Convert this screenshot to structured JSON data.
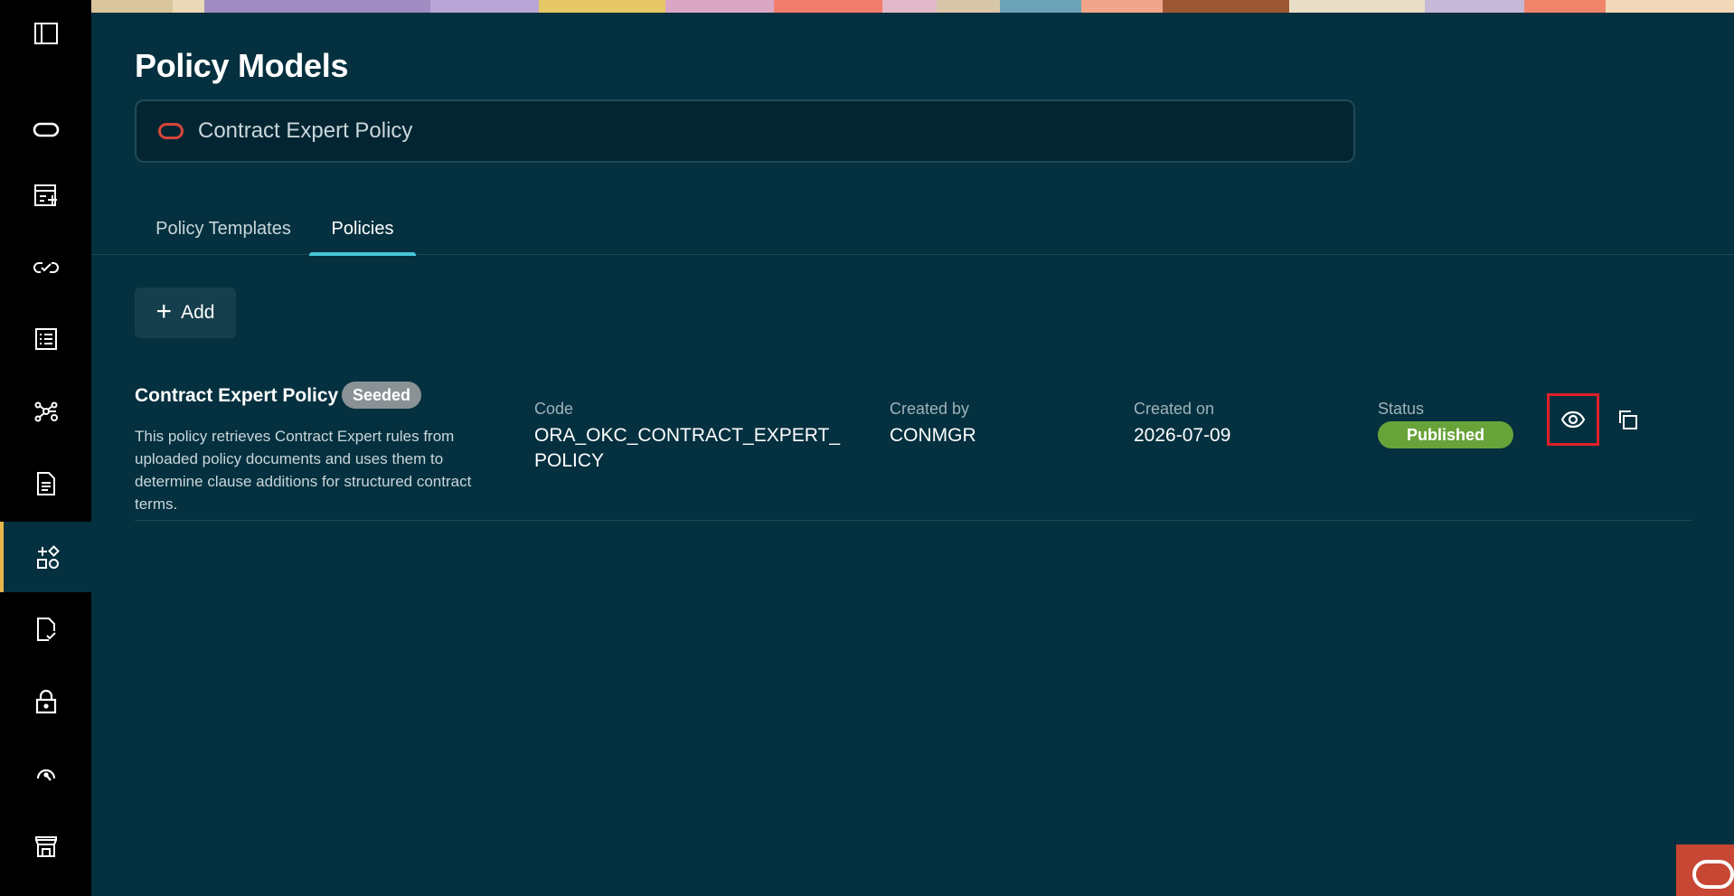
{
  "page": {
    "title": "Policy Models"
  },
  "selector": {
    "value": "Contract Expert Policy"
  },
  "tabs": [
    {
      "label": "Policy Templates",
      "selected": false
    },
    {
      "label": "Policies",
      "selected": true
    }
  ],
  "toolbar": {
    "add_label": "Add"
  },
  "columns": {
    "code": "Code",
    "created_by": "Created by",
    "created_on": "Created on",
    "status": "Status"
  },
  "policies": [
    {
      "name": "Contract Expert Policy",
      "badge": "Seeded",
      "description": "This policy retrieves Contract Expert rules from uploaded policy documents and uses them to determine clause additions for structured contract terms.",
      "code": "ORA_OKC_CONTRACT_EXPERT_POLICY",
      "created_by": "CONMGR",
      "created_on": "2026-07-09",
      "status": "Published"
    }
  ],
  "sidebar": {
    "items": [
      {
        "icon": "panel-toggle-icon"
      },
      {
        "icon": "oracle-logo-icon"
      },
      {
        "icon": "create-contract-icon"
      },
      {
        "icon": "link-check-icon"
      },
      {
        "icon": "list-document-icon"
      },
      {
        "icon": "network-icon"
      },
      {
        "icon": "document-icon"
      },
      {
        "icon": "apps-add-icon",
        "active": true
      },
      {
        "icon": "document-check-icon"
      },
      {
        "icon": "lock-icon"
      },
      {
        "icon": "gauge-icon"
      },
      {
        "icon": "store-icon"
      }
    ]
  },
  "colors": {
    "background": "#04303f",
    "sidebar": "#000000",
    "accent_tab": "#45c7d6",
    "active_marker": "#e8b54b",
    "published": "#68a33a",
    "seeded": "#8a9296",
    "highlight": "#e0202a",
    "oracle_red": "#c74634"
  }
}
